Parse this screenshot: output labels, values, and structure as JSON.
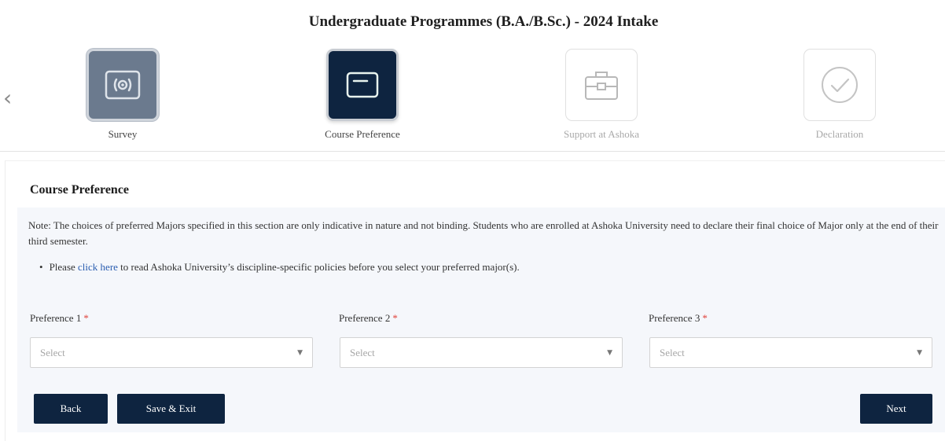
{
  "header": {
    "title": "Undergraduate Programmes (B.A./B.Sc.) - 2024 Intake"
  },
  "stepper": {
    "prev_icon": "chevron-left-icon",
    "steps": [
      {
        "label": "Survey",
        "icon": "survey-icon",
        "state": "completed"
      },
      {
        "label": "Course Preference",
        "icon": "window-icon",
        "state": "current"
      },
      {
        "label": "Support at Ashoka",
        "icon": "briefcase-icon",
        "state": "upcoming"
      },
      {
        "label": "Declaration",
        "icon": "check-circle-icon",
        "state": "upcoming"
      }
    ]
  },
  "section": {
    "title": "Course Preference",
    "note": "Note: The choices of preferred Majors specified in this section are only indicative in nature and not binding. Students who are enrolled at Ashoka University need to declare their final choice of Major only at the end of their third semester.",
    "bullet_prefix": "Please",
    "bullet_link": "click here",
    "bullet_suffix": "to read Ashoka University’s discipline-specific policies before you select your preferred major(s)."
  },
  "preferences": [
    {
      "label": "Preference 1",
      "required_mark": "*",
      "placeholder": "Select"
    },
    {
      "label": "Preference 2",
      "required_mark": "*",
      "placeholder": "Select"
    },
    {
      "label": "Preference 3",
      "required_mark": "*",
      "placeholder": "Select"
    }
  ],
  "actions": {
    "back": "Back",
    "save_exit": "Save & Exit",
    "next": "Next"
  },
  "colors": {
    "primary": "#0e2440",
    "completed_step": "#6b7a8e",
    "required": "#e0433b",
    "link": "#2a5db0",
    "panel": "#f5f7fb"
  }
}
